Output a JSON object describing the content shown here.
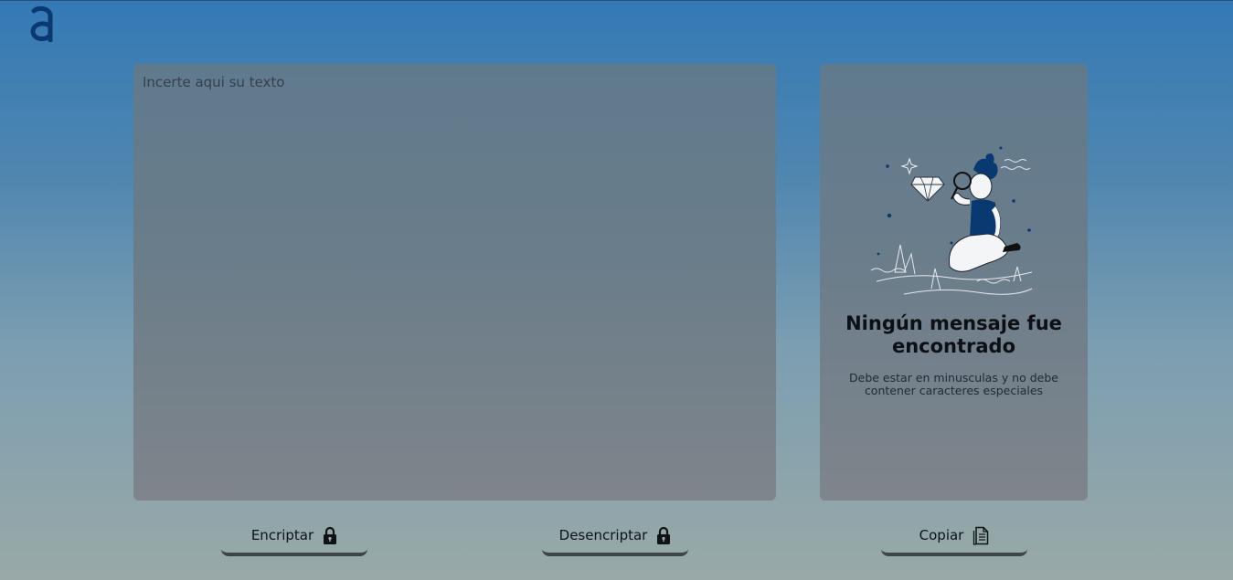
{
  "logo": {
    "icon": "alura-logo-icon",
    "color": "#0a3871"
  },
  "input": {
    "placeholder": "Incerte aqui su texto",
    "value": ""
  },
  "output": {
    "illustration": "person-with-magnifier-illustration",
    "title": "Ningún mensaje fue encontrado",
    "hint": "Debe estar en minusculas y no debe contener caracteres especiales"
  },
  "buttons": {
    "encrypt": {
      "label": "Encriptar",
      "icon": "lock-icon"
    },
    "decrypt": {
      "label": "Desencriptar",
      "icon": "lock-icon"
    },
    "copy": {
      "label": "Copiar",
      "icon": "copy-document-icon"
    }
  },
  "colors": {
    "accent": "#0a3871",
    "background_top": "#3479b5",
    "background_bottom": "#99a9a7"
  }
}
